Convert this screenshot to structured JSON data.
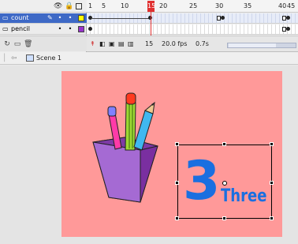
{
  "timeline": {
    "ruler_ticks": [
      "1",
      "5",
      "10",
      "15",
      "20",
      "25",
      "30",
      "35",
      "40",
      "45"
    ],
    "playhead_frame": "15",
    "layers": [
      {
        "name": "count",
        "color": "#ffff00",
        "selected": true
      },
      {
        "name": "pencil",
        "color": "#9933cc",
        "selected": false
      }
    ],
    "status": {
      "current_frame": "15",
      "fps": "20.0 fps",
      "time": "0.7s"
    }
  },
  "editbar": {
    "scene_label": "Scene 1"
  },
  "stage": {
    "background": "#ff9999",
    "number_text": "3",
    "word_text": "Three",
    "text_color": "#1a6fe0"
  }
}
